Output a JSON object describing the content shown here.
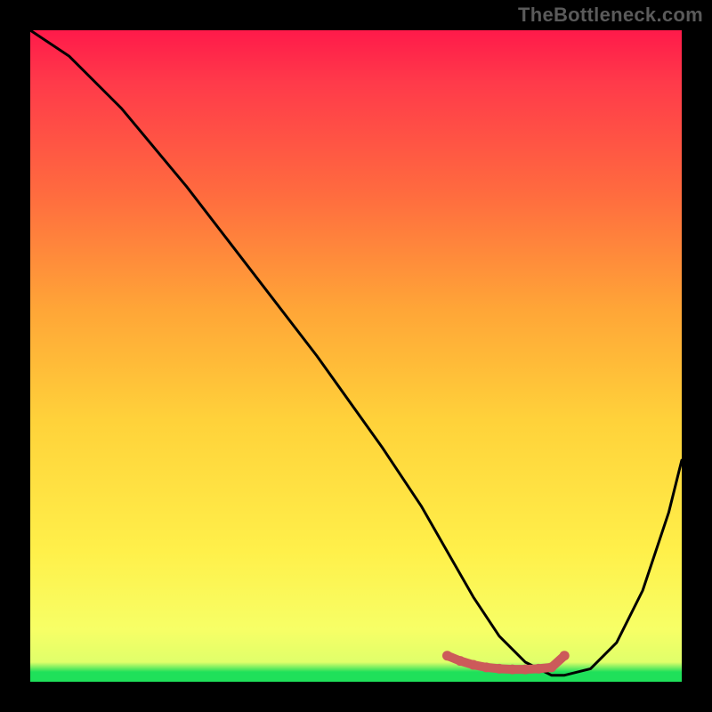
{
  "watermark": "TheBottleneck.com",
  "chart_data": {
    "type": "line",
    "title": "",
    "xlabel": "",
    "ylabel": "",
    "xlim": [
      0,
      100
    ],
    "ylim": [
      0,
      100
    ],
    "series": [
      {
        "name": "bottleneck-curve",
        "x": [
          0,
          6,
          14,
          24,
          34,
          44,
          54,
          60,
          64,
          68,
          72,
          76,
          80,
          82,
          86,
          90,
          94,
          98,
          100
        ],
        "y": [
          100,
          96,
          88,
          76,
          63,
          50,
          36,
          27,
          20,
          13,
          7,
          3,
          1,
          1,
          2,
          6,
          14,
          26,
          34
        ]
      }
    ],
    "highlight": {
      "name": "optimal-range",
      "color": "#cc5a5a",
      "x": [
        64,
        66,
        68,
        70,
        72,
        74,
        76,
        78,
        80,
        82
      ],
      "y": [
        4.0,
        3.2,
        2.6,
        2.2,
        2.0,
        1.9,
        1.9,
        2.0,
        2.2,
        4.0
      ]
    },
    "gradient_stops": [
      {
        "pos": 0.0,
        "color": "#ff1a4a"
      },
      {
        "pos": 0.25,
        "color": "#ff6b3f"
      },
      {
        "pos": 0.6,
        "color": "#ffd23a"
      },
      {
        "pos": 0.92,
        "color": "#f7ff66"
      },
      {
        "pos": 1.0,
        "color": "#1fe05a"
      }
    ]
  }
}
